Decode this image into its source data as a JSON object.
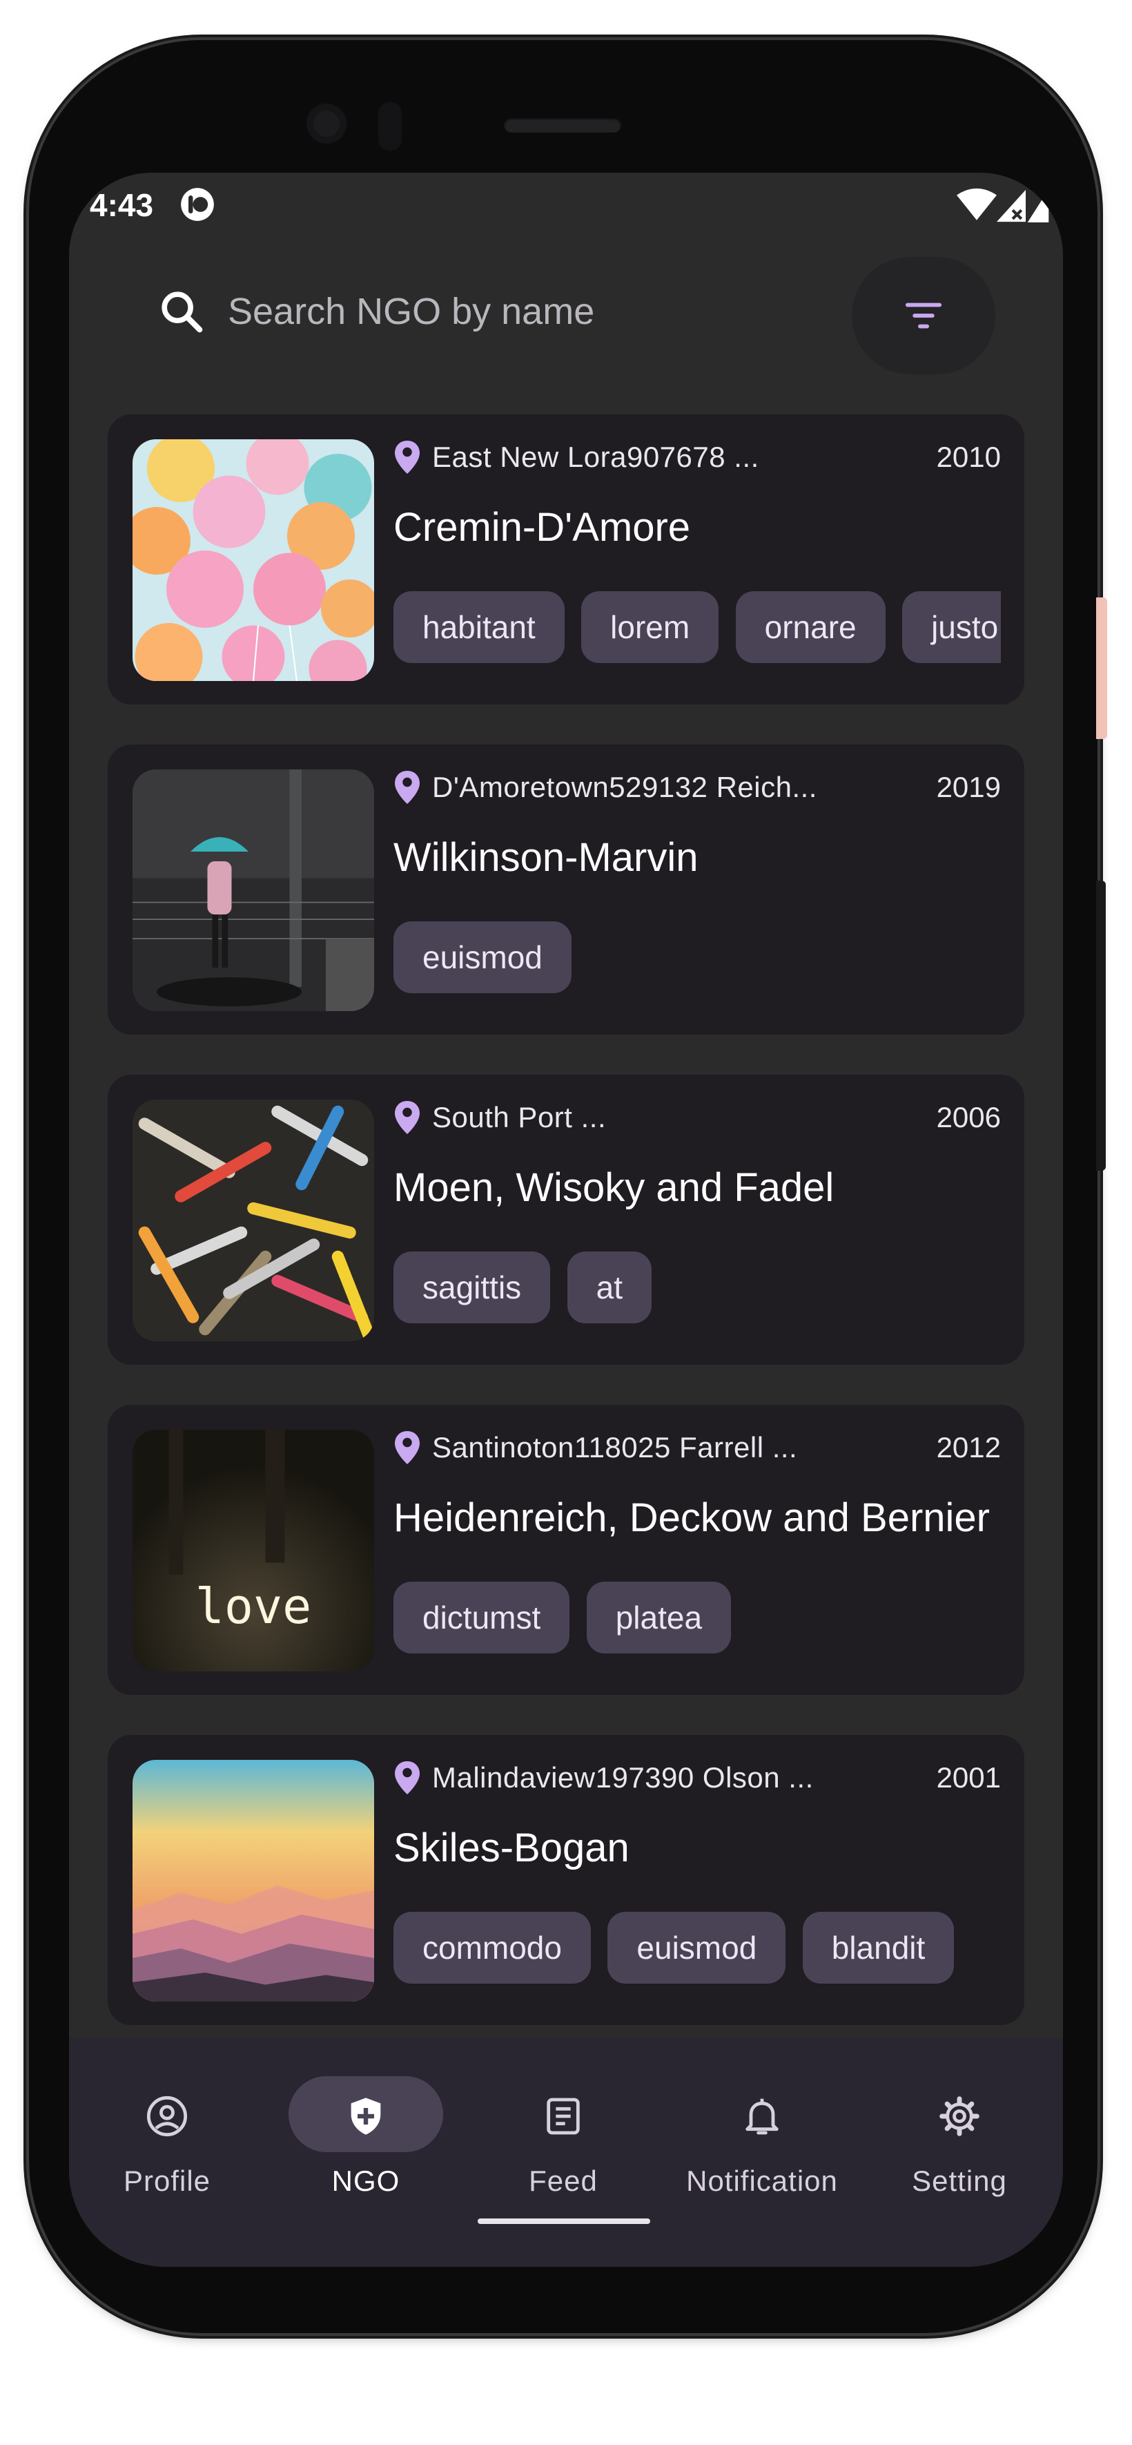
{
  "status_bar": {
    "time": "4:43"
  },
  "search": {
    "placeholder": "Search NGO by name"
  },
  "colors": {
    "background": "#2b2b2b",
    "card": "#1f1c22",
    "chip": "#4a4356",
    "accent": "#c9a9f0",
    "nav": "#2a2631"
  },
  "ngos": [
    {
      "location": "East New Lora907678 ...",
      "year": "2010",
      "name": "Cremin-D'Amore",
      "tags": [
        "habitant",
        "lorem",
        "ornare",
        "justo"
      ],
      "image": "balloons"
    },
    {
      "location": "D'Amoretown529132 Reich...",
      "year": "2019",
      "name": "Wilkinson-Marvin",
      "tags": [
        "euismod"
      ],
      "image": "umbrella-night"
    },
    {
      "location": "South Port ...",
      "year": "2006",
      "name": "Moen, Wisoky and Fadel",
      "tags": [
        "sagittis",
        "at"
      ],
      "image": "tools"
    },
    {
      "location": "Santinoton118025 Farrell ...",
      "year": "2012",
      "name": "Heidenreich, Deckow and Bernier",
      "tags": [
        "dictumst",
        "platea"
      ],
      "image": "love-sign",
      "image_text": "love"
    },
    {
      "location": "Malindaview197390 Olson ...",
      "year": "2001",
      "name": "Skiles-Bogan",
      "tags": [
        "commodo",
        "euismod",
        "blandit"
      ],
      "image": "sunset-mountains"
    }
  ],
  "bottom_nav": {
    "items": [
      {
        "label": "Profile",
        "icon": "account-circle-icon"
      },
      {
        "label": "NGO",
        "icon": "shield-plus-icon",
        "active": true
      },
      {
        "label": "Feed",
        "icon": "article-icon"
      },
      {
        "label": "Notification",
        "icon": "bell-icon"
      },
      {
        "label": "Setting",
        "icon": "gear-icon"
      }
    ]
  }
}
